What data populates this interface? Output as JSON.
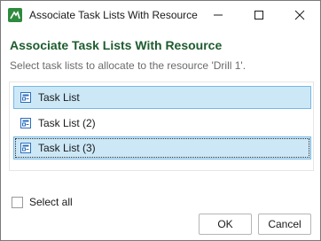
{
  "window": {
    "title": "Associate Task Lists With Resource",
    "minimize_icon": "minimize-icon",
    "maximize_icon": "maximize-icon",
    "close_icon": "close-icon"
  },
  "dialog": {
    "heading": "Associate Task Lists With Resource",
    "subtitle": "Select task lists to allocate to the resource 'Drill 1'.",
    "heading_color": "#1d5c2e",
    "selection_color": "#cce8f7"
  },
  "task_lists": [
    {
      "label": "Task List",
      "selected": true,
      "icon": "task-list-icon"
    },
    {
      "label": "Task List (2)",
      "selected": false,
      "icon": "task-list-icon"
    },
    {
      "label": "Task List (3)",
      "selected": true,
      "focused": true,
      "icon": "task-list-icon"
    }
  ],
  "select_all": {
    "label": "Select all",
    "checked": false
  },
  "buttons": {
    "ok": "OK",
    "cancel": "Cancel"
  }
}
